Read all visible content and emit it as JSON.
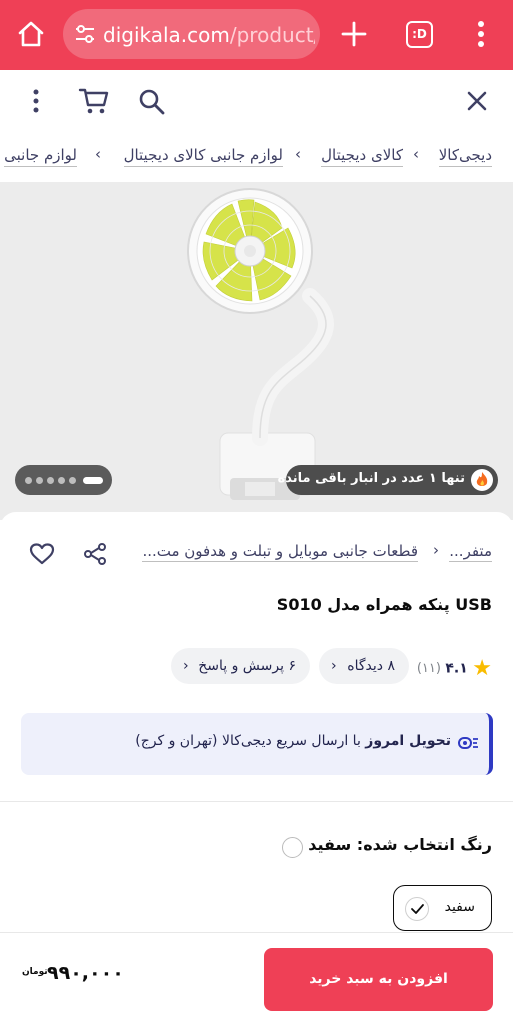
{
  "browser": {
    "url_domain": "digikala.com",
    "url_path": "/product/",
    "tab_badge": ":D",
    "home_icon": "home-icon",
    "tune_icon": "site-settings-icon",
    "plus_icon": "new-tab-icon",
    "menu_icon": "more-vert-icon"
  },
  "header": {
    "close_icon": "close-icon",
    "search_icon": "search-icon",
    "cart_icon": "cart-icon",
    "more_icon": "more-vert-icon"
  },
  "breadcrumb": {
    "items": [
      "دیجی‌کالا",
      "کالای دیجیتال",
      "لوازم جانبی کالای دیجیتال",
      "لوازم جانبی"
    ],
    "separator": "›"
  },
  "gallery": {
    "stock_notice": "تنها ۱ عدد در انبار باقی مانده",
    "fire_icon": "fire-icon",
    "image_count": 6,
    "active_index": 0
  },
  "product": {
    "category_1": "متفر...",
    "category_2": "قطعات جانبی موبایل و تبلت و هدفون مت...",
    "share_icon": "share-icon",
    "favorite_icon": "heart-icon",
    "title": "USB پنکه همراه مدل S010",
    "rating_value": "۴.۱",
    "rating_count": "(۱۱)",
    "star_icon": "star-icon",
    "reviews_label": "۸ دیدگاه",
    "questions_label": "۶ پرسش و پاسخ",
    "chevron": "›"
  },
  "delivery": {
    "bold_text": "تحویل امروز",
    "rest_text": " با ارسال سریع دیجی‌کالا (تهران و کرج)",
    "icon": "fast-delivery-icon"
  },
  "color": {
    "label": "رنگ انتخاب شده: سفید",
    "option_label": "سفید",
    "check_icon": "check-icon",
    "swatch": "#ffffff"
  },
  "buy": {
    "add_to_cart": "افزودن به سبد خرید",
    "price": "۹۹۰,۰۰۰",
    "currency": "تومان"
  },
  "colors": {
    "brand": "#ef4056",
    "accent_blue": "#2f3ac3",
    "star": "#f9bc00"
  }
}
